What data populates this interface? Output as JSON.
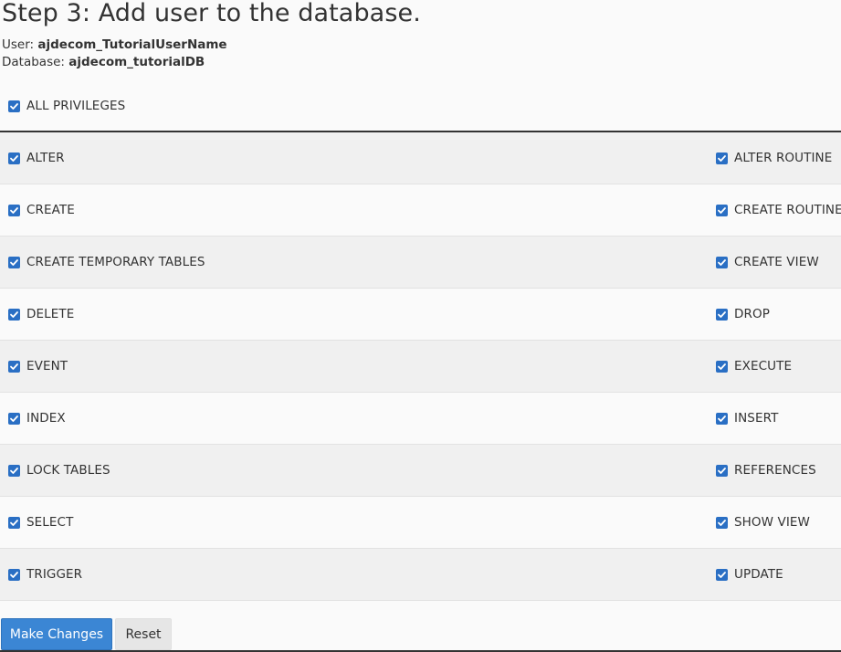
{
  "header": {
    "title": "Step 3: Add user to the database.",
    "user_label": "User:",
    "user_value": "ajdecom_TutorialUserName",
    "database_label": "Database:",
    "database_value": "ajdecom_tutorialDB"
  },
  "all_privileges": {
    "label": "ALL PRIVILEGES",
    "checked": true
  },
  "privileges": {
    "left": [
      {
        "label": "ALTER",
        "checked": true
      },
      {
        "label": "CREATE",
        "checked": true
      },
      {
        "label": "CREATE TEMPORARY TABLES",
        "checked": true
      },
      {
        "label": "DELETE",
        "checked": true
      },
      {
        "label": "EVENT",
        "checked": true
      },
      {
        "label": "INDEX",
        "checked": true
      },
      {
        "label": "LOCK TABLES",
        "checked": true
      },
      {
        "label": "SELECT",
        "checked": true
      },
      {
        "label": "TRIGGER",
        "checked": true
      }
    ],
    "right": [
      {
        "label": "ALTER ROUTINE",
        "checked": true
      },
      {
        "label": "CREATE ROUTINE",
        "checked": true
      },
      {
        "label": "CREATE VIEW",
        "checked": true
      },
      {
        "label": "DROP",
        "checked": true
      },
      {
        "label": "EXECUTE",
        "checked": true
      },
      {
        "label": "INSERT",
        "checked": true
      },
      {
        "label": "REFERENCES",
        "checked": true
      },
      {
        "label": "SHOW VIEW",
        "checked": true
      },
      {
        "label": "UPDATE",
        "checked": true
      }
    ]
  },
  "buttons": {
    "make_changes": "Make Changes",
    "reset": "Reset"
  },
  "colors": {
    "checkbox": "#2a6fc4",
    "primary_button": "#3b86d4",
    "row_alt": "#f0f0f0"
  }
}
